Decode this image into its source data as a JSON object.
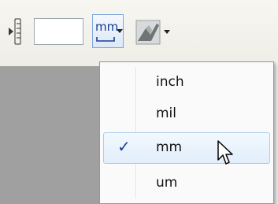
{
  "toolbar": {
    "spacing_value": "",
    "units_glyph": "mm",
    "units_ruler_color": "#1a3d8f",
    "tool_icon": "pen-tool-icon"
  },
  "units_menu": {
    "items": [
      {
        "label": "inch",
        "checked": false
      },
      {
        "label": "mil",
        "checked": false
      },
      {
        "label": "mm",
        "checked": true
      },
      {
        "label": "um",
        "checked": false
      }
    ],
    "check_glyph": "✓",
    "check_color": "#1b3f9a",
    "highlight_color": "#a8cbef"
  }
}
